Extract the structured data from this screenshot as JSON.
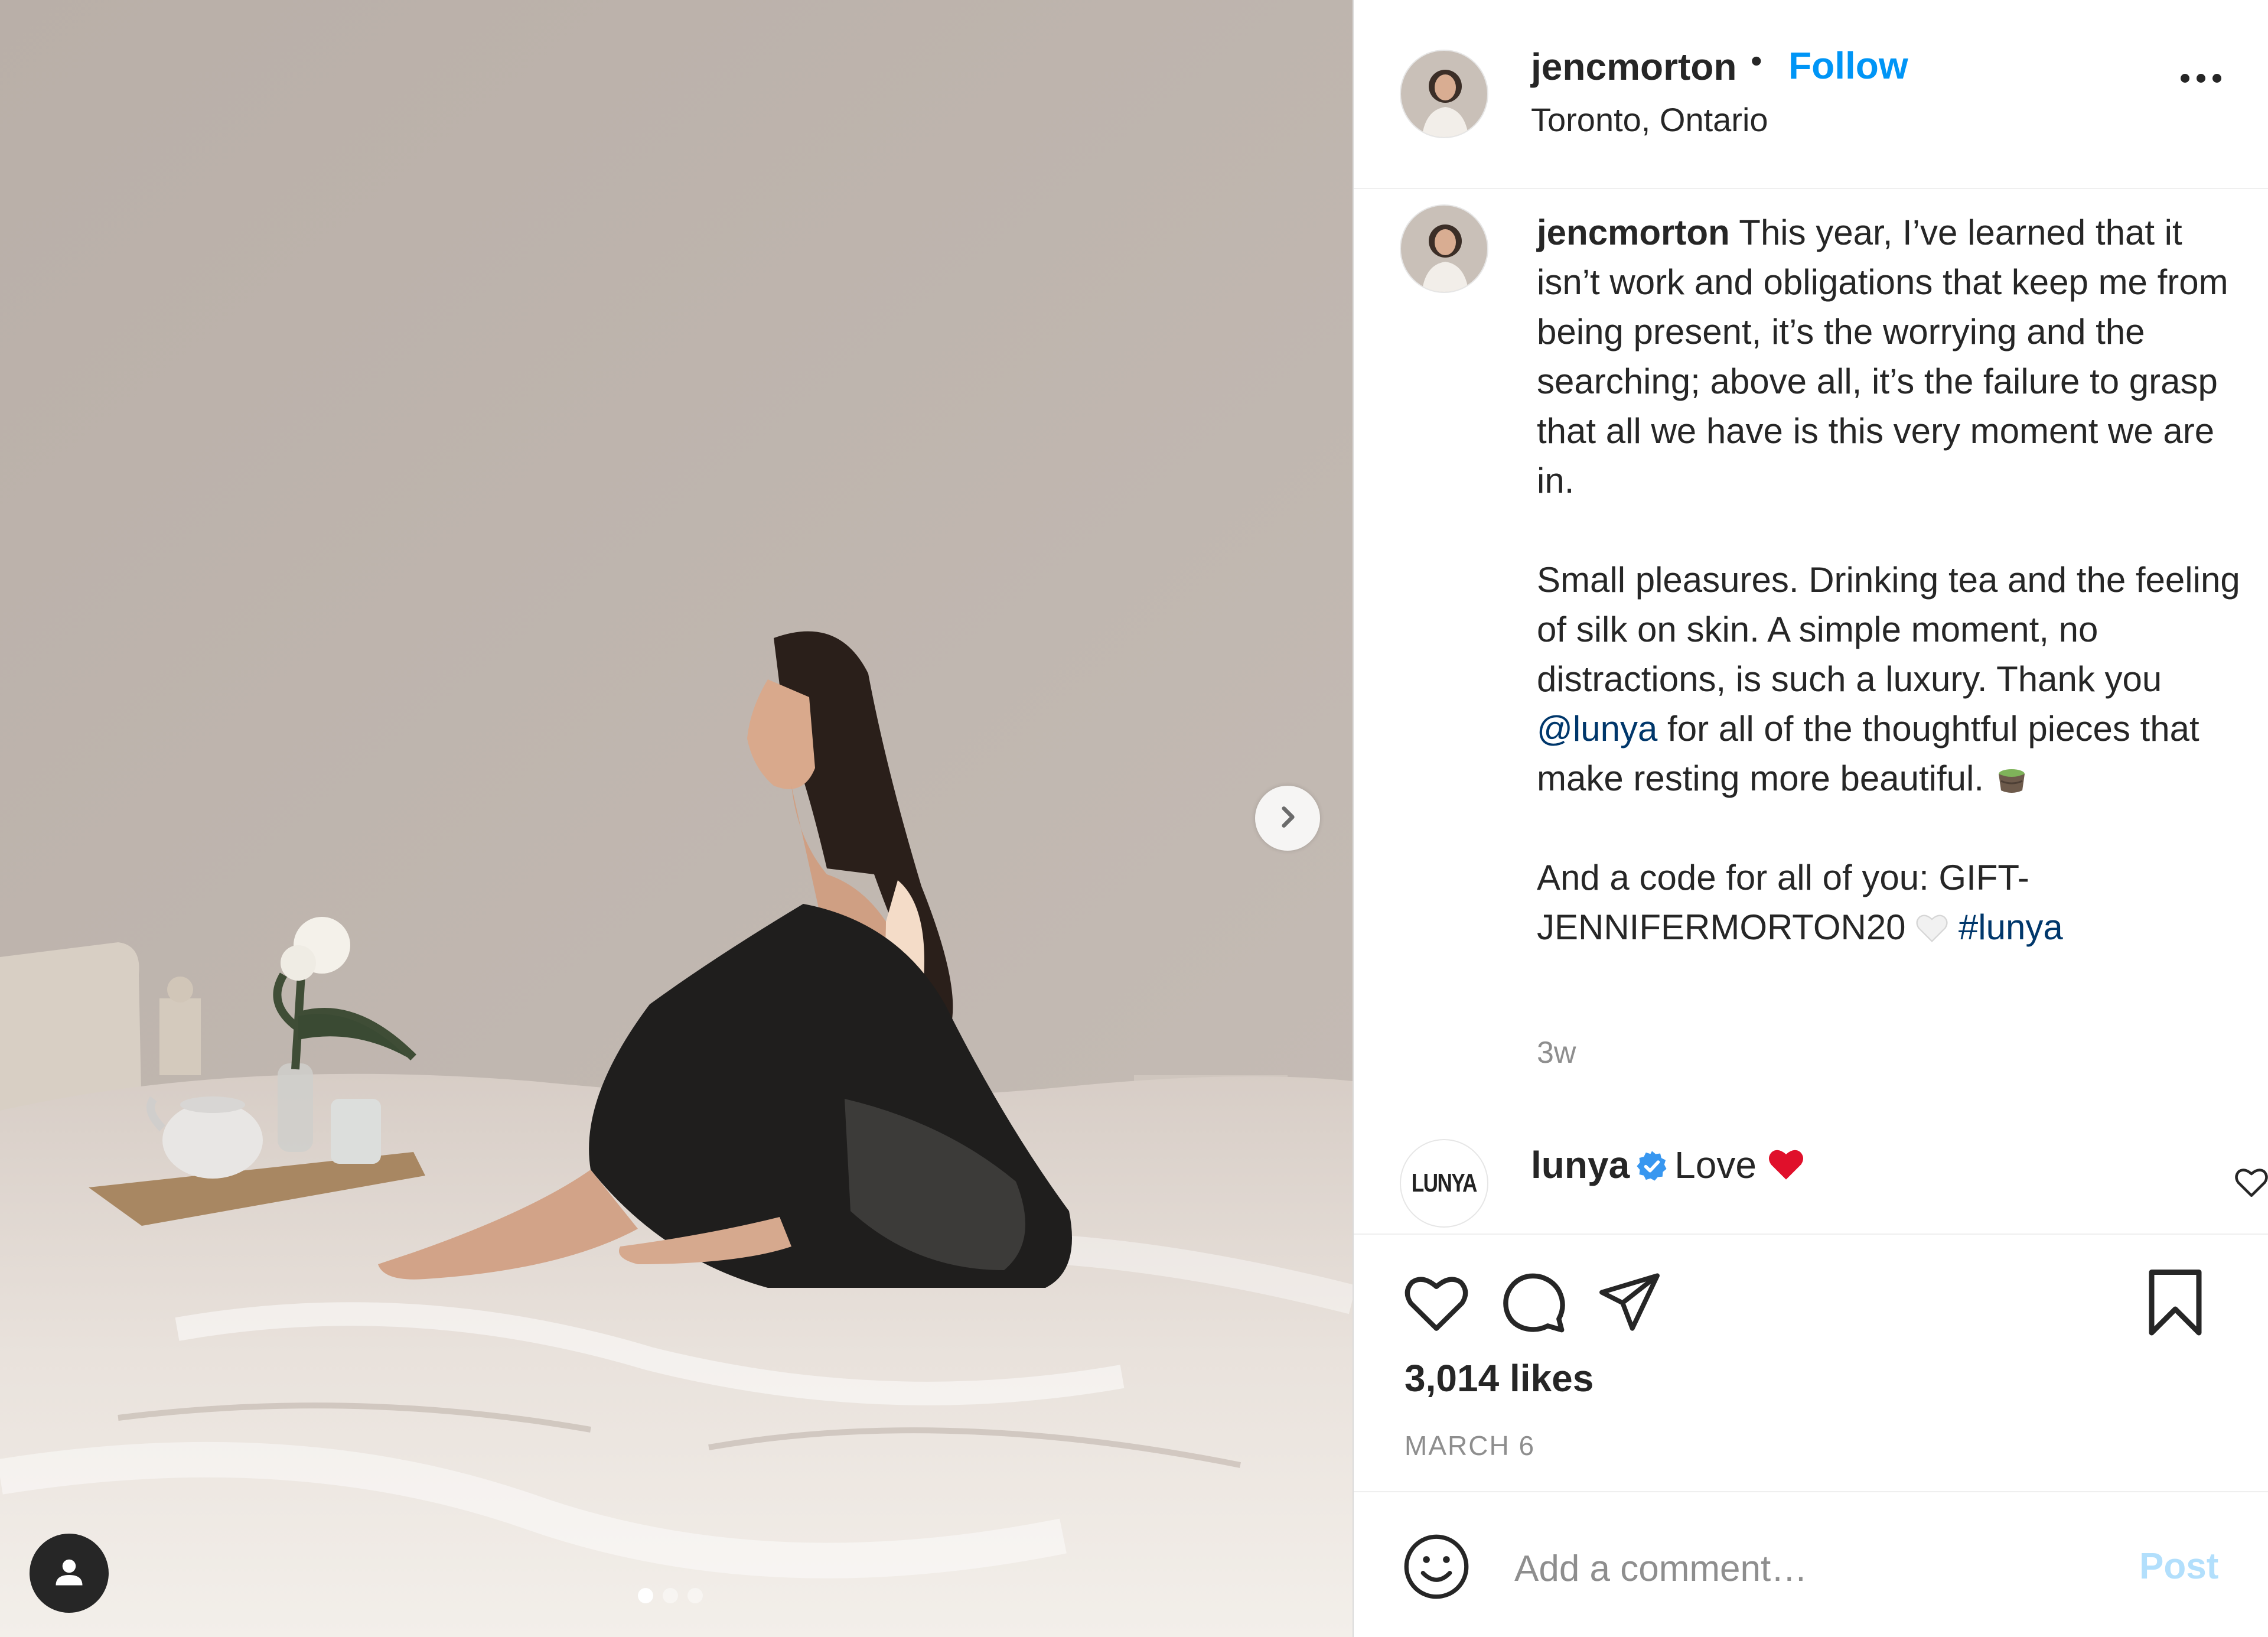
{
  "post": {
    "username": "jencmorton",
    "separator": "•",
    "follow_label": "Follow",
    "location": "Toronto, Ontario"
  },
  "caption": {
    "username": "jencmorton",
    "paragraph1": " This year, I’ve learned that it isn’t work and obligations that keep me from being present, it’s the worrying and the searching; above all, it’s the failure to grasp that all we have is this very moment we are in.",
    "paragraph2_a": "Small pleasures. Drinking tea and the feeling of silk on skin. A simple moment, no distractions, is such a luxury. Thank you ",
    "mention": "@lunya",
    "paragraph2_b": " for all of the thoughtful pieces that make resting more beautiful. ",
    "paragraph3_a": "And a code for all of you: GIFT-JENNIFERMORTON20 ",
    "hashtag": "#lunya",
    "time_ago": "3w"
  },
  "comment": {
    "avatar_text": "LUNYA",
    "username": "lunya",
    "text": "Love"
  },
  "stats": {
    "likes": "3,014 likes",
    "date": "MARCH 6"
  },
  "composer": {
    "placeholder": "Add a comment…",
    "post_label": "Post"
  },
  "icons": {
    "like": "heart-icon",
    "comment": "comment-bubble-icon",
    "share": "paper-plane-icon",
    "save": "bookmark-icon",
    "emoji": "smiley-icon",
    "next": "chevron-right-icon",
    "tags": "user-icon"
  },
  "colors": {
    "link": "#0095f6",
    "mention": "#00376b",
    "muted": "#8e8e8e",
    "verified": "#3897f0"
  },
  "carousel": {
    "slides": 3,
    "active_slide": 1
  }
}
